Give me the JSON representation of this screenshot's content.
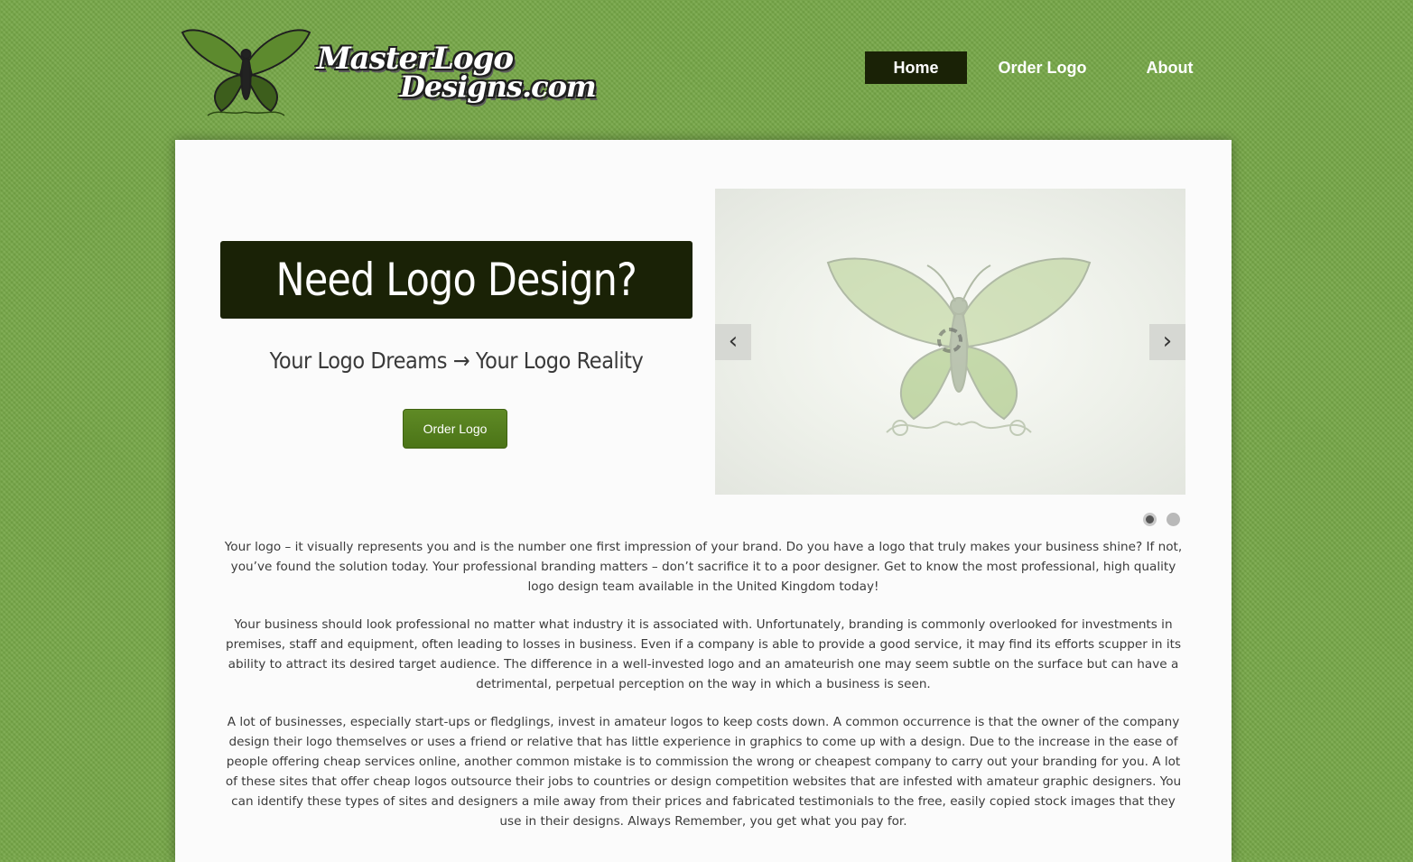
{
  "header": {
    "logo": {
      "line1": "MasterLogo",
      "line2": "Designs.com"
    },
    "nav": [
      {
        "label": "Home",
        "active": true
      },
      {
        "label": "Order Logo",
        "active": false
      },
      {
        "label": "About",
        "active": false
      }
    ]
  },
  "hero": {
    "title": "Need Logo Design?",
    "tagline": "Your Logo Dreams → Your Logo Reality",
    "button_label": "Order Logo"
  },
  "slider": {
    "prev_label": "‹",
    "next_label": "›",
    "slide_count": 2,
    "active_slide": 1
  },
  "content": {
    "paragraphs": [
      "Your logo – it visually represents you and is the number one first impression of your brand. Do you have a logo that truly makes your business shine? If not, you’ve found the solution today. Your professional branding matters – don’t sacrifice it to a poor designer. Get to know the most professional, high quality logo design team available in the United Kingdom today!",
      "Your business should look professional no matter what industry it is associated with. Unfortunately, branding is commonly overlooked for investments in premises, staff and equipment, often leading to losses in business. Even if a company is able to provide a good service, it may find its efforts scupper in its ability to attract its desired target audience. The difference in a well-invested logo and an amateurish one may seem subtle on the surface but can have a detrimental, perpetual perception on the way in which a business is seen.",
      "A lot of businesses, especially start-ups or fledglings, invest in amateur logos to keep costs down. A common occurrence is that the owner of the company design their logo themselves or uses a friend or relative that has little experience in graphics to come up with a design. Due to the increase in the ease of people offering cheap services online, another common mistake is to commission the wrong or cheapest company to carry out your branding for you. A lot of these sites that offer cheap logos outsource their jobs to countries or design competition websites that are infested with amateur graphic designers. You can identify these types of sites and designers a mile away from their prices and fabricated testimonials to the free, easily copied stock images that they use in their designs. Always Remember, you get what you pay for."
    ]
  },
  "colors": {
    "background": "#76a747",
    "dark_accent": "#1a2206",
    "button": "#4f7a1b",
    "panel": "#fbfbfb"
  }
}
